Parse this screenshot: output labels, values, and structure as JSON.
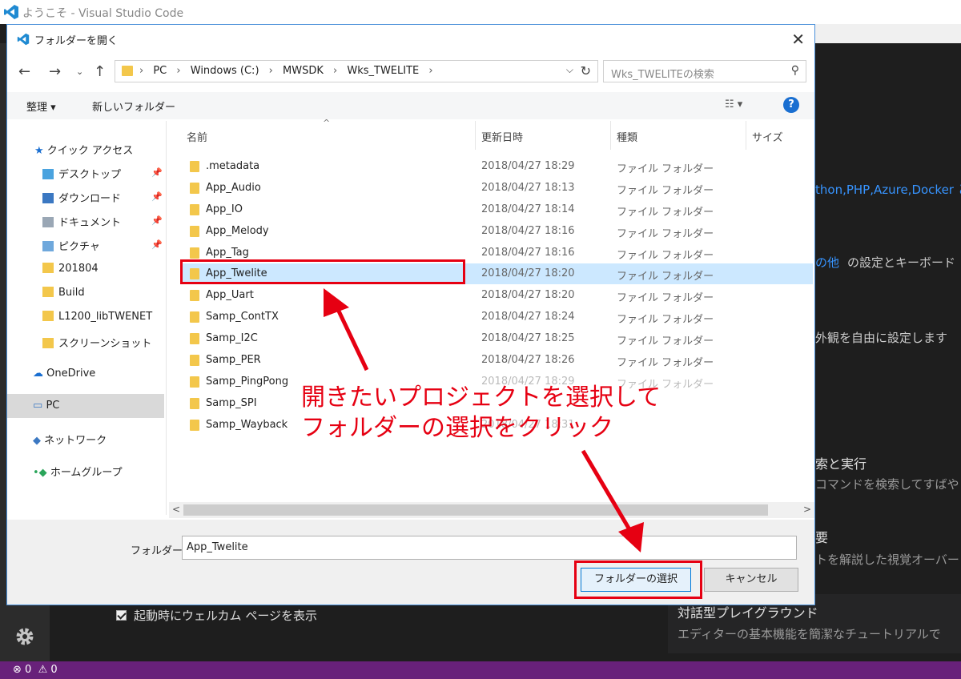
{
  "window": {
    "title": "ようこそ - Visual Studio Code"
  },
  "welcome": {
    "text1": "thon,PHP,Azure,Docker と",
    "text2_link": "の他",
    "text2": "の設定とキーボード",
    "text3": "外観を自由に設定します",
    "text4_title": "索と実行",
    "text4_sub": "コマンドを検索してすばや",
    "text5_title": "要",
    "text5_sub": "トを解説した視覚オーバー",
    "text6_title": "対話型プレイグラウンド",
    "text6_sub": "エディターの基本機能を簡潔なチュートリアルで",
    "startup_label": "起動時にウェルカム ページを表示"
  },
  "statusbar": {
    "errors": "0",
    "warnings": "0"
  },
  "dialog": {
    "title": "フォルダーを開く",
    "address": [
      "PC",
      "Windows (C:)",
      "MWSDK",
      "Wks_TWELITE"
    ],
    "search_placeholder": "Wks_TWELITEの検索",
    "toolbar": {
      "organize": "整理 ▾",
      "new_folder": "新しいフォルダー"
    },
    "nav": {
      "quick": "クイック アクセス",
      "items": [
        "デスクトップ",
        "ダウンロード",
        "ドキュメント",
        "ピクチャ",
        "201804",
        "Build",
        "L1200_libTWENET",
        "スクリーンショット"
      ],
      "onedrive": "OneDrive",
      "pc": "PC",
      "network": "ネットワーク",
      "homegroup": "ホームグループ"
    },
    "columns": {
      "name": "名前",
      "date": "更新日時",
      "type": "種類",
      "size": "サイズ"
    },
    "rows": [
      {
        "name": ".metadata",
        "date": "2018/04/27 18:29",
        "type": "ファイル フォルダー"
      },
      {
        "name": "App_Audio",
        "date": "2018/04/27 18:13",
        "type": "ファイル フォルダー"
      },
      {
        "name": "App_IO",
        "date": "2018/04/27 18:14",
        "type": "ファイル フォルダー"
      },
      {
        "name": "App_Melody",
        "date": "2018/04/27 18:16",
        "type": "ファイル フォルダー"
      },
      {
        "name": "App_Tag",
        "date": "2018/04/27 18:16",
        "type": "ファイル フォルダー"
      },
      {
        "name": "App_Twelite",
        "date": "2018/04/27 18:20",
        "type": "ファイル フォルダー"
      },
      {
        "name": "App_Uart",
        "date": "2018/04/27 18:20",
        "type": "ファイル フォルダー"
      },
      {
        "name": "Samp_ContTX",
        "date": "2018/04/27 18:24",
        "type": "ファイル フォルダー"
      },
      {
        "name": "Samp_I2C",
        "date": "2018/04/27 18:25",
        "type": "ファイル フォルダー"
      },
      {
        "name": "Samp_PER",
        "date": "2018/04/27 18:26",
        "type": "ファイル フォルダー"
      },
      {
        "name": "Samp_PingPong",
        "date": "2018/04/27 18:29",
        "type": "ファイル フォルダー"
      },
      {
        "name": "Samp_SPI",
        "date": "",
        "type": ""
      },
      {
        "name": "Samp_Wayback",
        "date": "2018/04/27 18:31",
        "type": ""
      }
    ],
    "folder_label": "フォルダー:",
    "folder_value": "App_Twelite",
    "select_button": "フォルダーの選択",
    "cancel_button": "キャンセル"
  },
  "annotation": {
    "line1": "開きたいプロジェクトを選択して",
    "line2": "フォルダーの選択をクリック",
    "color": "#e60012"
  }
}
